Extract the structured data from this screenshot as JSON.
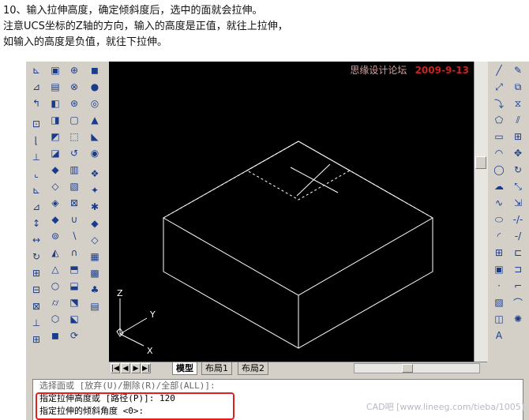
{
  "instructions": [
    "10、输入拉伸高度，确定倾斜度后，选中的面就会拉伸。",
    "注意UCS坐标的Z轴的方向，输入的高度是正值，就往上拉伸，",
    "如输入的高度是负值，就往下拉伸。"
  ],
  "watermark": {
    "site": "思缘设计论坛",
    "date": "2009-9-13"
  },
  "ucs": {
    "z": "Z",
    "y": "Y",
    "x": "X"
  },
  "tabs": {
    "model": "模型",
    "layout1": "布局1",
    "layout2": "布局2"
  },
  "nav": {
    "first": "|◀",
    "prev": "◀",
    "next": "▶",
    "last": "▶|"
  },
  "command": {
    "lines": [
      "选择面或 [放弃(U)/删除(R)/全部(ALL)]:",
      "指定拉伸高度或 [路径(P)]: 120",
      "指定拉伸的倾斜角度 <0>:"
    ]
  },
  "footer_watermark": "CAD吧 [www.lineeg.com/tieba/1005]"
}
